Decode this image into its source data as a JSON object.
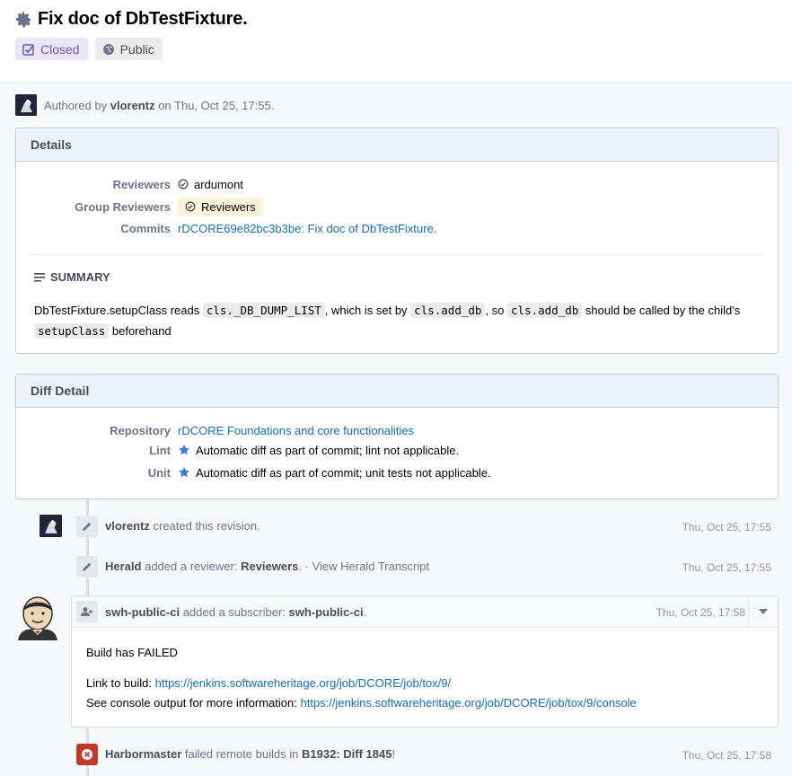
{
  "header": {
    "title": "Fix doc of DbTestFixture.",
    "status_tag": "Closed",
    "visibility_tag": "Public"
  },
  "authored": {
    "prefix": "Authored by",
    "author": "vlorentz",
    "suffix": "on Thu, Oct 25, 17:55."
  },
  "details": {
    "heading": "Details",
    "reviewers_label": "Reviewers",
    "reviewers_value": "ardumont",
    "group_reviewers_label": "Group Reviewers",
    "group_reviewers_value": "Reviewers",
    "commits_label": "Commits",
    "commits_value": "rDCORE69e82bc3b3be: Fix doc of DbTestFixture.",
    "summary_heading": "SUMMARY",
    "summary": {
      "part1": "DbTestFixture.setupClass reads ",
      "code1": "cls._DB_DUMP_LIST",
      "part2": ", which is set by ",
      "code2": "cls.add_db",
      "part3": ", so ",
      "code3": "cls.add_db",
      "part4": " should be called by the child's",
      "code4": "setupClass",
      "part5": " beforehand"
    }
  },
  "diff_detail": {
    "heading": "Diff Detail",
    "repository_label": "Repository",
    "repository_value": "rDCORE Foundations and core functionalities",
    "lint_label": "Lint",
    "lint_value": "Automatic diff as part of commit; lint not applicable.",
    "unit_label": "Unit",
    "unit_value": "Automatic diff as part of commit; unit tests not applicable."
  },
  "timeline": {
    "event1": {
      "actor": "vlorentz",
      "text": "created this revision.",
      "time": "Thu, Oct 25, 17:55"
    },
    "event2": {
      "actor": "Herald",
      "text1": "added a reviewer:",
      "target": "Reviewers",
      "text2": ". ·",
      "link": "View Herald Transcript",
      "time": "Thu, Oct 25, 17:55"
    },
    "event3": {
      "actor": "swh-public-ci",
      "text": "added a subscriber:",
      "target": "swh-public-ci",
      "dot": ".",
      "time": "Thu, Oct 25, 17:58",
      "body_line1": "Build has FAILED",
      "link_label": "Link to build:",
      "build_url": "https://jenkins.softwareheritage.org/job/DCORE/job/tox/9/",
      "console_label": "See console output for more information:",
      "console_url": "https://jenkins.softwareheritage.org/job/DCORE/job/tox/9/console"
    },
    "event4": {
      "actor": "Harbormaster",
      "text": "failed remote builds in",
      "target": "B1932: Diff 1845",
      "bang": "!",
      "time": "Thu, Oct 25, 17:58"
    }
  },
  "colors": {
    "link": "#136cb2",
    "closed_tag": "#6e5cb6",
    "panel_head": "#edf3fb",
    "fail": "#c0392b"
  }
}
